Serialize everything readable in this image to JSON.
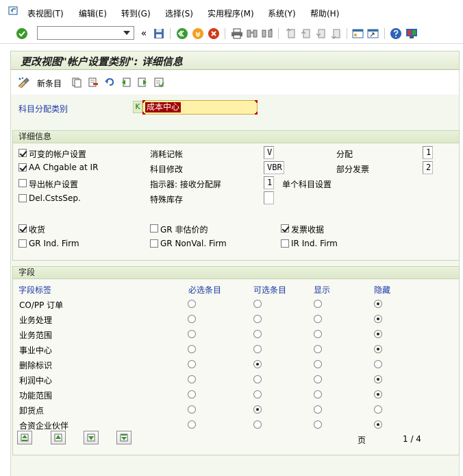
{
  "menubar": {
    "items": [
      "表视图(T)",
      "编辑(E)",
      "转到(G)",
      "选择(S)",
      "实用程序(M)",
      "系统(Y)",
      "帮助(H)"
    ]
  },
  "toolbar": {
    "command_value": "",
    "icons": [
      "check-icon",
      "back-arrows-icon",
      "save-icon",
      "back-icon",
      "exit-icon",
      "cancel-icon",
      "print-icon",
      "find-icon",
      "find-next-icon",
      "first-page-icon",
      "previous-page-icon",
      "next-page-icon",
      "last-page-icon",
      "new-session-icon",
      "shortcut-icon",
      "help-icon",
      "customize-layout-icon"
    ]
  },
  "screen": {
    "title": "更改视图\"帐户设置类别\": 详细信息"
  },
  "app_toolbar": {
    "new_entries_label": "新条目"
  },
  "header_field": {
    "label": "科目分配类别",
    "key": "K",
    "value": "成本中心"
  },
  "details": {
    "title": "详细信息",
    "col1": [
      {
        "label": "可变的帐户设置",
        "checked": true
      },
      {
        "label": "AA Chgable at IR",
        "checked": true
      },
      {
        "label": "导出帐户设置",
        "checked": false
      },
      {
        "label": "Del.CstsSep.",
        "checked": false
      }
    ],
    "col2": [
      {
        "label": "消耗记帐",
        "value": "V"
      },
      {
        "label": "科目修改",
        "value": "VBR"
      },
      {
        "label": "指示器: 接收分配屏",
        "value": "1",
        "suffix": "单个科目设置"
      },
      {
        "label": "特殊库存",
        "value": ""
      }
    ],
    "col3": [
      {
        "label": "分配",
        "value": "1"
      },
      {
        "label": "部分发票",
        "value": "2"
      }
    ],
    "flags_row1": [
      {
        "label": "收货",
        "checked": true
      },
      {
        "label": "GR 非估价的",
        "checked": false
      },
      {
        "label": "发票收据",
        "checked": true
      }
    ],
    "flags_row2": [
      {
        "label": "GR Ind. Firm",
        "checked": false
      },
      {
        "label": "GR NonVal. Firm",
        "checked": false
      },
      {
        "label": "IR Ind. Firm",
        "checked": false
      }
    ]
  },
  "fields": {
    "title": "字段",
    "headers": [
      "字段标签",
      "必选条目",
      "可选条目",
      "显示",
      "隐藏"
    ],
    "rows": [
      {
        "label": "CO/PP 订单",
        "selected": 3
      },
      {
        "label": "业务处理",
        "selected": 3
      },
      {
        "label": "业务范围",
        "selected": 3
      },
      {
        "label": "事业中心",
        "selected": 3
      },
      {
        "label": "删除标识",
        "selected": 1
      },
      {
        "label": "利润中心",
        "selected": 3
      },
      {
        "label": "功能范围",
        "selected": 3
      },
      {
        "label": "卸货点",
        "selected": 1
      },
      {
        "label": "合资企业伙伴",
        "selected": 3
      }
    ],
    "page_label": "页",
    "page_value": "1 / 4"
  }
}
